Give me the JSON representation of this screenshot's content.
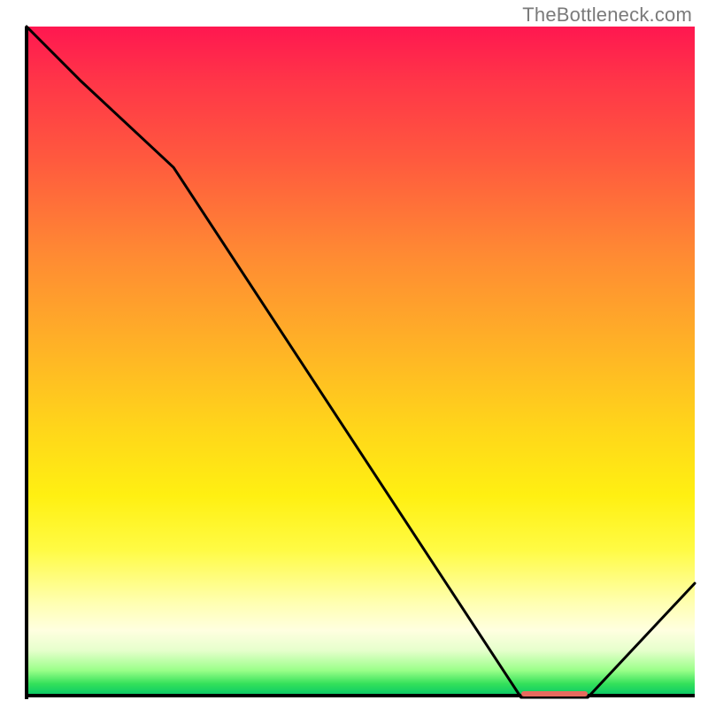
{
  "watermark": "TheBottleneck.com",
  "chart_data": {
    "type": "line",
    "title": "",
    "xlabel": "",
    "ylabel": "",
    "xlim": [
      0,
      100
    ],
    "ylim": [
      0,
      100
    ],
    "grid": false,
    "legend": false,
    "x": [
      0,
      8,
      22,
      74,
      84,
      100
    ],
    "values": [
      100,
      92,
      79,
      0,
      0,
      17
    ],
    "marker_region_x": [
      74,
      84
    ],
    "marker_y": 0.5,
    "notes": "x and y are percentages of the plot area; the curve descends from upper-left, kinks near x≈22, reaches the baseline ~x≈74–84, then rises. A short salmon marker sits on the baseline over the flat minimum."
  },
  "colors": {
    "curve": "#000000",
    "marker": "#e86a5e",
    "axis": "#000000",
    "gradient_top": "#ff1750",
    "gradient_bottom": "#00c46a"
  }
}
